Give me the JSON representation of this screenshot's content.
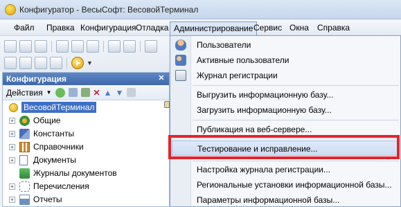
{
  "window": {
    "title": "Конфигуратор - ВесыСофт: ВесовойТерминал"
  },
  "menubar": {
    "items": [
      {
        "label": "Файл"
      },
      {
        "label": "Правка"
      },
      {
        "label": "Конфигурация"
      },
      {
        "label": "Отладка"
      },
      {
        "label": "Администрирование"
      },
      {
        "label": "Сервис"
      },
      {
        "label": "Окна"
      },
      {
        "label": "Справка"
      }
    ],
    "active": "Администрирование"
  },
  "config_panel": {
    "title": "Конфигурация",
    "actions_label": "Действия",
    "tree": {
      "root": "ВесовойТерминал",
      "items": [
        {
          "label": "Общие",
          "icon": "common-icon",
          "color": "#3a8f3a"
        },
        {
          "label": "Константы",
          "icon": "constants-icon",
          "color": "#4a6fb8"
        },
        {
          "label": "Справочники",
          "icon": "catalogs-icon",
          "color": "#d08a2a"
        },
        {
          "label": "Документы",
          "icon": "documents-icon",
          "color": "#5a7fb5"
        },
        {
          "label": "Журналы документов",
          "icon": "journals-icon",
          "color": "#3f9c4a"
        },
        {
          "label": "Перечисления",
          "icon": "enums-icon",
          "color": "#5a7fb5"
        },
        {
          "label": "Отчеты",
          "icon": "reports-icon",
          "color": "#6f8fbf"
        }
      ]
    }
  },
  "admin_menu": {
    "items": [
      {
        "label": "Пользователи",
        "icon": "user-icon"
      },
      {
        "label": "Активные пользователи",
        "icon": "active-users-icon"
      },
      {
        "label": "Журнал регистрации",
        "icon": "log-icon"
      },
      {
        "label": "Выгрузить информационную базу..."
      },
      {
        "label": "Загрузить информационную базу..."
      },
      {
        "label": "Публикация на веб-сервере..."
      },
      {
        "label": "Тестирование и исправление...",
        "highlighted": true
      },
      {
        "label": "Настройка журнала регистрации..."
      },
      {
        "label": "Региональные установки информационной базы..."
      },
      {
        "label": "Параметры информационной базы..."
      }
    ]
  },
  "colors": {
    "highlight_box": "#e3242b",
    "panel_header": "#4a73b6",
    "selection": "#3d6fc4"
  }
}
